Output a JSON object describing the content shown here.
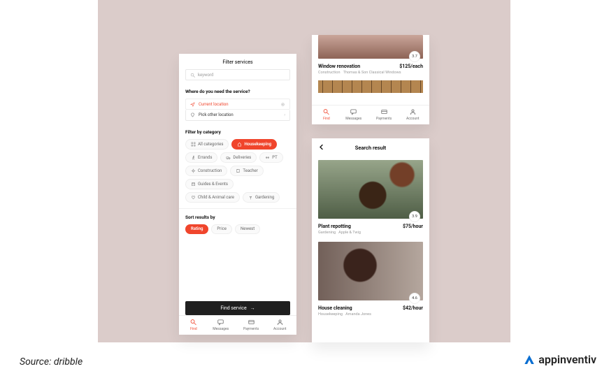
{
  "colors": {
    "accent": "#f0452c",
    "cta_bg": "#1f1f1f",
    "backdrop": "#dbccca"
  },
  "phone1": {
    "title": "Filter services",
    "search_placeholder": "keyword",
    "where_label": "Where do you need the service?",
    "loc_current": "Current location",
    "loc_other": "Pick other location",
    "category_label": "Filter by category",
    "categories": [
      {
        "label": "All categories",
        "icon": "grid"
      },
      {
        "label": "Housekeeping",
        "icon": "house",
        "active": true
      },
      {
        "label": "Errands",
        "icon": "person-run"
      },
      {
        "label": "Deliveries",
        "icon": "truck"
      },
      {
        "label": "PT",
        "icon": "dumbbell"
      },
      {
        "label": "Construction",
        "icon": "wrench-gear"
      },
      {
        "label": "Teacher",
        "icon": "book"
      },
      {
        "label": "Guides & Events",
        "icon": "calendar"
      },
      {
        "label": "Child & Animal care",
        "icon": "heart"
      },
      {
        "label": "Gardening",
        "icon": "plant"
      }
    ],
    "sort_label": "Sort results by",
    "sort_options": [
      {
        "label": "Rating",
        "active": true
      },
      {
        "label": "Price"
      },
      {
        "label": "Newest"
      }
    ],
    "cta": "Find service"
  },
  "bottom_nav": [
    {
      "label": "Find",
      "icon": "search",
      "active": true
    },
    {
      "label": "Messages",
      "icon": "chat"
    },
    {
      "label": "Payments",
      "icon": "card"
    },
    {
      "label": "Account",
      "icon": "user"
    }
  ],
  "phone2": {
    "card": {
      "title": "Window renovation",
      "price": "$125/each",
      "category": "Construction",
      "vendor": "Thomas & Son Classical Windows",
      "rating": "3.7"
    },
    "bottom_nav_ref": "bottom_nav"
  },
  "phone3": {
    "title": "Search result",
    "cards": [
      {
        "title": "Plant repotting",
        "price": "$75/hour",
        "category": "Gardening",
        "vendor": "Apple & Twig",
        "rating": "3.9"
      },
      {
        "title": "House cleaning",
        "price": "$42/hour",
        "category": "Housekeeping",
        "vendor": "Amanda Jones",
        "rating": "4.6"
      }
    ]
  },
  "source_label": "Source: dribble",
  "brand_label": "appinventiv"
}
